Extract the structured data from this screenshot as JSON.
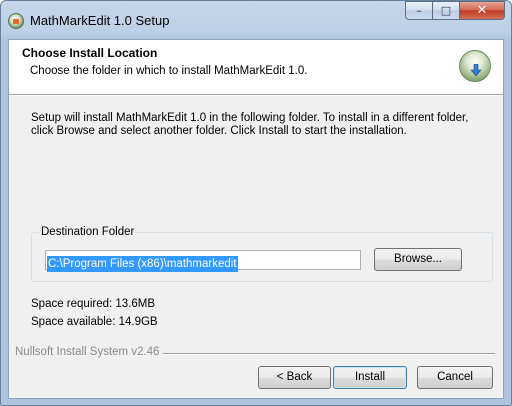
{
  "window": {
    "title": "MathMarkEdit 1.0 Setup",
    "controls": {
      "minimize": "–",
      "maximize": "□",
      "close": "✕"
    }
  },
  "header": {
    "title": "Choose Install Location",
    "subtitle": "Choose the folder in which to install MathMarkEdit 1.0.",
    "logo_icon": "installer-globe-icon"
  },
  "body": {
    "intro": "Setup will install MathMarkEdit 1.0 in the following folder. To install in a different folder, click Browse and select another folder. Click Install to start the installation."
  },
  "destination": {
    "label": "Destination Folder",
    "path": "C:\\Program Files (x86)\\mathmarkedit",
    "browse_label": "Browse..."
  },
  "space": {
    "required": "Space required: 13.6MB",
    "available": "Space available: 14.9GB"
  },
  "footer": {
    "branding": "Nullsoft Install System v2.46",
    "back_label": "< Back",
    "install_label": "Install",
    "cancel_label": "Cancel"
  },
  "colors": {
    "accent_selection": "#3399ff",
    "dialog_bg": "#f0f0f0",
    "close_button": "#c0391f"
  }
}
